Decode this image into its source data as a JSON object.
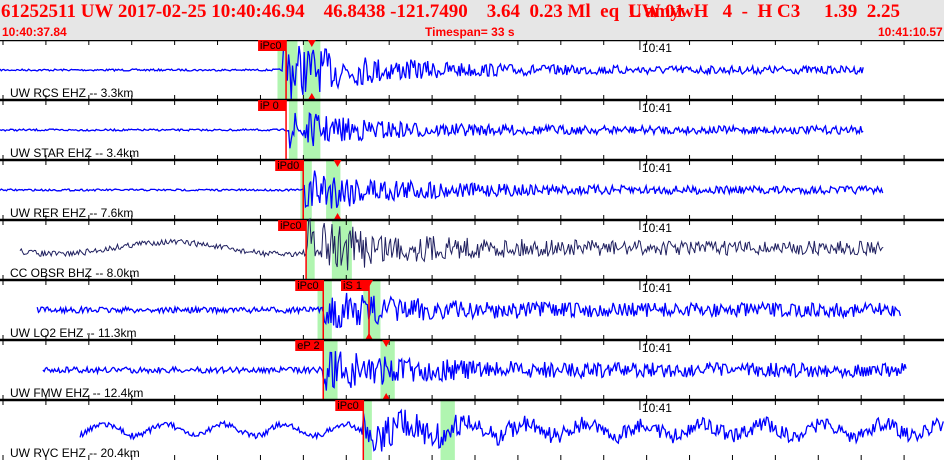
{
  "header": {
    "event_line_left": "61252511 UW 2017-02-25 10:40:46.94    46.8438 -121.7490    3.64  0.23 Ml  eq  L amyw",
    "event_line_right": "UW 01  H   4  -  H C3     1.39  2.25",
    "start_time": "10:40:37.84",
    "timespan": "Timespan=  33 s",
    "end_time": "10:41:10.57"
  },
  "time_axis": {
    "span_seconds": 33,
    "minute_tick_seconds": 22.16,
    "minute_label": "10:41"
  },
  "colors": {
    "trace": "#0000ff",
    "trace_bb": "#202060",
    "pick": "#ff0000",
    "window": "#b0f5b0",
    "header_text": "#ff0000"
  },
  "traces": [
    {
      "label": "UW RCS EHZ -- 3.3km",
      "picks": [
        {
          "text": "iPc0",
          "t": 10.0
        }
      ],
      "windows": [
        [
          9.7,
          10.4
        ],
        [
          10.6,
          11.2
        ]
      ],
      "s_marker": 10.9,
      "amp": 1,
      "start": 0,
      "end": 30.2,
      "p": 9.9
    },
    {
      "label": "UW STAR EHZ -- 3.4km",
      "picks": [
        {
          "text": "iP 0",
          "t": 10.0
        }
      ],
      "windows": [
        [
          10.1,
          10.4
        ],
        [
          10.6,
          11.2
        ]
      ],
      "amp": 0.6,
      "start": 0,
      "end": 30.2,
      "p": 10.1
    },
    {
      "label": "UW RER EHZ -- 7.6km",
      "picks": [
        {
          "text": "iPd0",
          "t": 10.6
        }
      ],
      "windows": [
        [
          10.5,
          10.9
        ],
        [
          11.4,
          11.9
        ]
      ],
      "s_marker": 11.8,
      "amp": 0.8,
      "start": 0,
      "end": 30.9,
      "p": 10.6
    },
    {
      "label": "CC OBSR BHZ -- 8.0km",
      "picks": [
        {
          "text": "iPc0",
          "t": 10.7
        }
      ],
      "windows": [
        [
          10.7,
          11.0
        ],
        [
          11.6,
          12.3
        ]
      ],
      "amp": 0.9,
      "start": 0.7,
      "end": 30.9,
      "p": 10.7,
      "bb": true
    },
    {
      "label": "UW LO2 EHZ -- 11.3km",
      "picks": [
        {
          "text": "iPc0",
          "t": 11.3
        },
        {
          "text": "iS 1",
          "t": 12.9
        }
      ],
      "windows": [
        [
          11.1,
          11.6
        ],
        [
          12.7,
          13.3
        ]
      ],
      "s_marker": 12.9,
      "amp": 0.5,
      "start": 1.3,
      "end": 31.5,
      "p": 11.3
    },
    {
      "label": "UW FMW EHZ -- 12.4km",
      "picks": [
        {
          "text": "eP 2",
          "t": 11.3
        }
      ],
      "windows": [
        [
          11.3,
          11.8
        ],
        [
          13.3,
          13.8
        ]
      ],
      "s_marker": 13.5,
      "amp": 0.6,
      "start": 1.5,
      "end": 31.7,
      "p": 11.3
    },
    {
      "label": "UW RVC EHZ -- 20.4km",
      "picks": [
        {
          "text": "iPc0",
          "t": 12.7
        }
      ],
      "windows": [
        [
          12.7,
          13.0
        ],
        [
          15.4,
          15.9
        ]
      ],
      "amp": 0.5,
      "start": 2.8,
      "end": 33,
      "p": 12.7
    }
  ]
}
